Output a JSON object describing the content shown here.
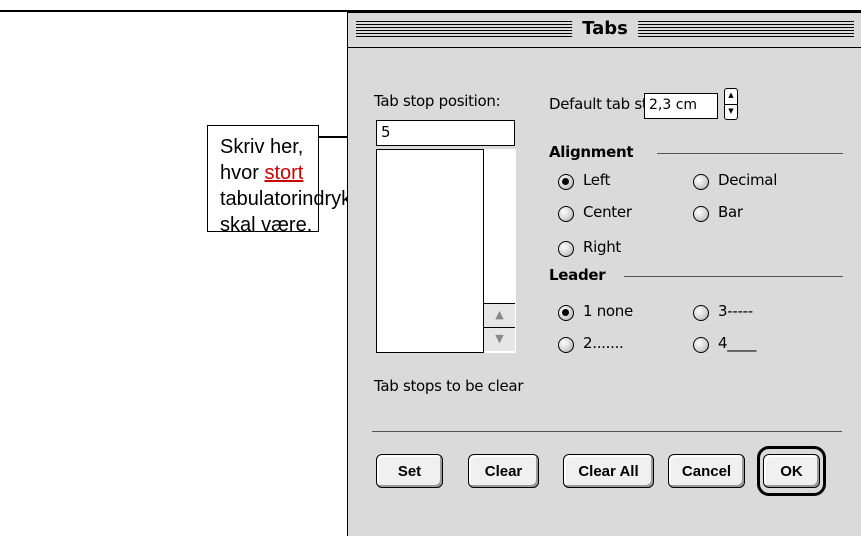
{
  "annotation": {
    "text_before": "Skriv her, hvor ",
    "highlight": "stort",
    "text_after": " tabulatorindrykket skal være."
  },
  "dialog": {
    "title": "Tabs",
    "tab_stop_position_label": "Tab stop position:",
    "tab_stop_position_value": "5",
    "default_tab_stops_label": "Default tab stops:",
    "default_tab_stops_value": "2,3 cm",
    "alignment": {
      "heading": "Alignment",
      "options": [
        "Left",
        "Decimal",
        "Center",
        "Bar",
        "Right"
      ],
      "selected": "Left"
    },
    "leader": {
      "heading": "Leader",
      "options": [
        "1 none",
        "3-----",
        "2.......",
        "4____"
      ],
      "selected": "1 none"
    },
    "tab_stops_to_be_clear_label": "Tab stops to be clear",
    "buttons": {
      "set": "Set",
      "clear": "Clear",
      "clear_all": "Clear All",
      "cancel": "Cancel",
      "ok": "OK"
    },
    "icons": [
      "scroll-up-icon",
      "scroll-down-icon",
      "stepper-up-icon",
      "stepper-down-icon"
    ]
  }
}
